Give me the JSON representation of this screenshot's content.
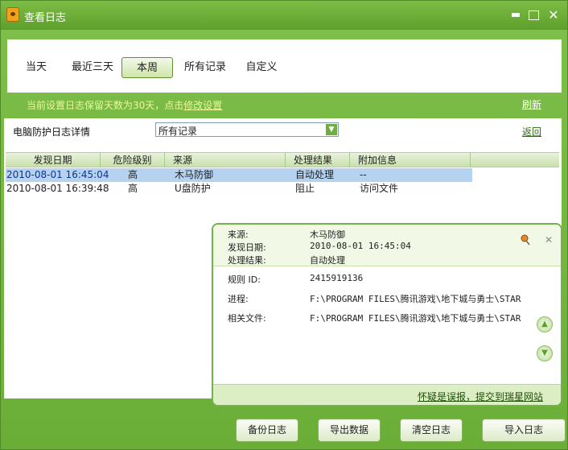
{
  "window": {
    "title": "查看日志"
  },
  "tabs": [
    {
      "label": "当天"
    },
    {
      "label": "最近三天"
    },
    {
      "label": "本周"
    },
    {
      "label": "所有记录"
    },
    {
      "label": "自定义"
    }
  ],
  "active_tab": "本周",
  "notice": {
    "text": "当前设置日志保留天数为30天，点击",
    "link": "修改设置"
  },
  "refresh_label": "刷新",
  "detail": {
    "title": "电脑防护日志详情",
    "filter_value": "所有记录",
    "back_label": "返回"
  },
  "table": {
    "columns": [
      "发现日期",
      "危险级别",
      "来源",
      "处理结果",
      "附加信息"
    ],
    "rows": [
      {
        "date": "2010-08-01 16:45:04",
        "level": "高",
        "source": "木马防御",
        "result": "自动处理",
        "info": "--"
      },
      {
        "date": "2010-08-01 16:39:48",
        "level": "高",
        "source": "U盘防护",
        "result": "阻止",
        "info": "访问文件"
      }
    ]
  },
  "popup": {
    "source_label": "来源:",
    "source_value": "木马防御",
    "date_label": "发现日期:",
    "date_value": "2010-08-01 16:45:04",
    "result_label": "处理结果:",
    "result_value": "自动处理",
    "rule_label": "规则 ID:",
    "rule_value": "2415919136",
    "process_label": "进程:",
    "process_value": "F:\\PROGRAM FILES\\腾讯游戏\\地下城与勇士\\STAR",
    "file_label": "相关文件:",
    "file_value": "F:\\PROGRAM FILES\\腾讯游戏\\地下城与勇士\\STAR",
    "report_link": "怀疑是误报，提交到瑞星网站"
  },
  "buttons": {
    "backup": "备份日志",
    "export": "导出数据",
    "clear": "清空日志",
    "import": "导入日志"
  },
  "icons": {
    "app": "tiger-icon",
    "minimize": "minimize-icon",
    "maximize": "maximize-icon",
    "close": "close-icon",
    "pin": "pin-icon",
    "dropdown": "chevron-down-icon",
    "scroll_up": "chevron-up-icon",
    "scroll_down": "chevron-down-icon"
  },
  "colors": {
    "brand_green": "#6aae38",
    "notice_text": "#ecf79a",
    "selected_row": "#b5d3f0"
  }
}
